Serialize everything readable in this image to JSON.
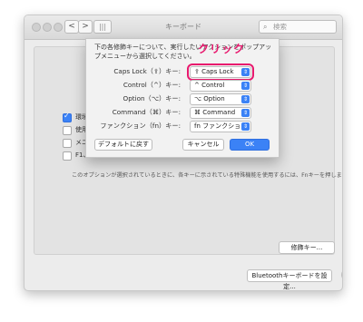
{
  "window": {
    "title": "キーボード"
  },
  "toolbar": {
    "back": "<",
    "forward": ">",
    "grid": "|||"
  },
  "search": {
    "placeholder": "検索"
  },
  "background": {
    "checkboxes": [
      {
        "label": "環境ヤ",
        "checked": true
      },
      {
        "label": "使用",
        "checked": false
      },
      {
        "label": "メニ",
        "checked": false
      },
      {
        "label": "F1、F",
        "checked": false
      }
    ],
    "note": "このオプションが選択されているときに、各キーに示されている特殊機能を使用するには、Fnキーを押します。",
    "modifier_button": "修飾キー...",
    "bluetooth_button": "Bluetoothキーボードを設定...",
    "help_button": "?"
  },
  "sheet": {
    "instruction": "下の各修飾キーについて、実行したいアクションをポップアップメニューから選択してください。",
    "rows": [
      {
        "label": "Caps Lock（⇪）キー:",
        "value": "⇪ Caps Lock"
      },
      {
        "label": "Control（^）キー:",
        "value": "^ Control"
      },
      {
        "label": "Option（⌥）キー:",
        "value": "⌥ Option"
      },
      {
        "label": "Command（⌘）キー:",
        "value": "⌘ Command"
      },
      {
        "label": "ファンクション（fn）キー:",
        "value": "fn ファンクション"
      }
    ],
    "default_button": "デフォルトに戻す",
    "cancel_button": "キャンセル",
    "ok_button": "OK"
  },
  "annotation": {
    "callout": "クリック",
    "color": "#e8196e"
  },
  "colors": {
    "accent": "#3b82f6"
  }
}
